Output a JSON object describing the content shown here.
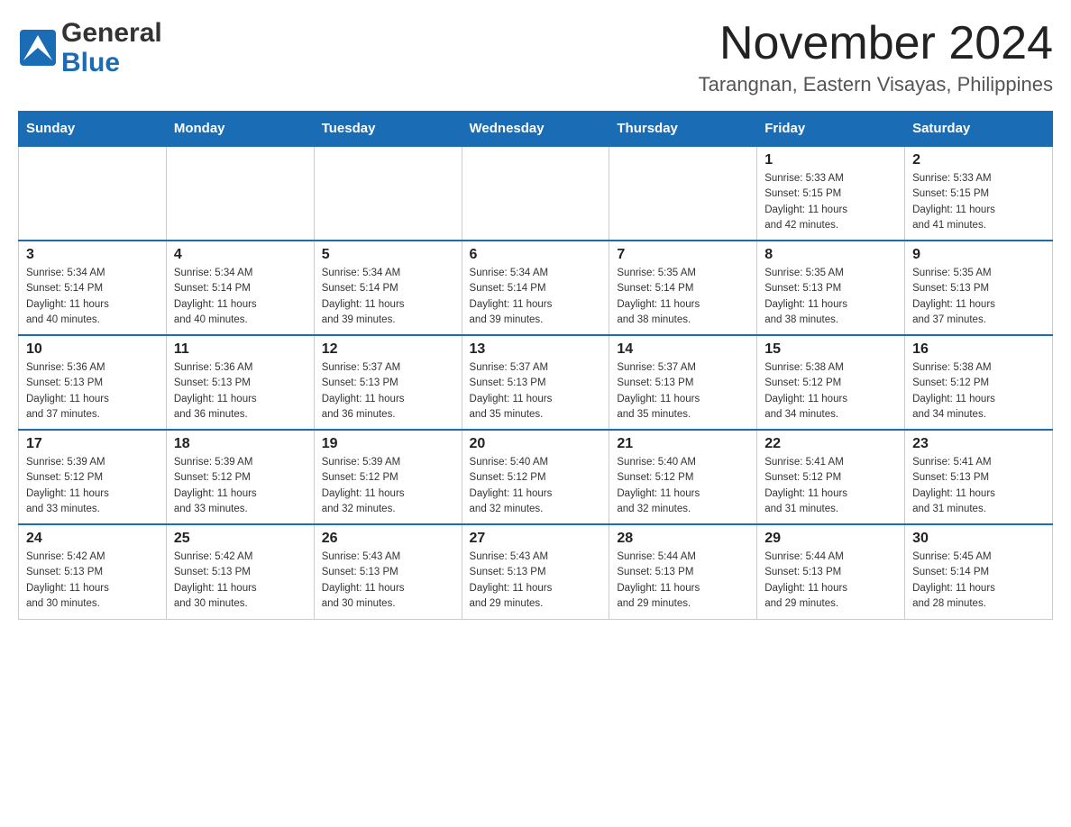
{
  "header": {
    "logo_general": "General",
    "logo_blue": "Blue",
    "month_title": "November 2024",
    "location": "Tarangnan, Eastern Visayas, Philippines"
  },
  "days_of_week": [
    "Sunday",
    "Monday",
    "Tuesday",
    "Wednesday",
    "Thursday",
    "Friday",
    "Saturday"
  ],
  "weeks": [
    {
      "days": [
        {
          "day": "",
          "info": ""
        },
        {
          "day": "",
          "info": ""
        },
        {
          "day": "",
          "info": ""
        },
        {
          "day": "",
          "info": ""
        },
        {
          "day": "",
          "info": ""
        },
        {
          "day": "1",
          "info": "Sunrise: 5:33 AM\nSunset: 5:15 PM\nDaylight: 11 hours\nand 42 minutes."
        },
        {
          "day": "2",
          "info": "Sunrise: 5:33 AM\nSunset: 5:15 PM\nDaylight: 11 hours\nand 41 minutes."
        }
      ]
    },
    {
      "days": [
        {
          "day": "3",
          "info": "Sunrise: 5:34 AM\nSunset: 5:14 PM\nDaylight: 11 hours\nand 40 minutes."
        },
        {
          "day": "4",
          "info": "Sunrise: 5:34 AM\nSunset: 5:14 PM\nDaylight: 11 hours\nand 40 minutes."
        },
        {
          "day": "5",
          "info": "Sunrise: 5:34 AM\nSunset: 5:14 PM\nDaylight: 11 hours\nand 39 minutes."
        },
        {
          "day": "6",
          "info": "Sunrise: 5:34 AM\nSunset: 5:14 PM\nDaylight: 11 hours\nand 39 minutes."
        },
        {
          "day": "7",
          "info": "Sunrise: 5:35 AM\nSunset: 5:14 PM\nDaylight: 11 hours\nand 38 minutes."
        },
        {
          "day": "8",
          "info": "Sunrise: 5:35 AM\nSunset: 5:13 PM\nDaylight: 11 hours\nand 38 minutes."
        },
        {
          "day": "9",
          "info": "Sunrise: 5:35 AM\nSunset: 5:13 PM\nDaylight: 11 hours\nand 37 minutes."
        }
      ]
    },
    {
      "days": [
        {
          "day": "10",
          "info": "Sunrise: 5:36 AM\nSunset: 5:13 PM\nDaylight: 11 hours\nand 37 minutes."
        },
        {
          "day": "11",
          "info": "Sunrise: 5:36 AM\nSunset: 5:13 PM\nDaylight: 11 hours\nand 36 minutes."
        },
        {
          "day": "12",
          "info": "Sunrise: 5:37 AM\nSunset: 5:13 PM\nDaylight: 11 hours\nand 36 minutes."
        },
        {
          "day": "13",
          "info": "Sunrise: 5:37 AM\nSunset: 5:13 PM\nDaylight: 11 hours\nand 35 minutes."
        },
        {
          "day": "14",
          "info": "Sunrise: 5:37 AM\nSunset: 5:13 PM\nDaylight: 11 hours\nand 35 minutes."
        },
        {
          "day": "15",
          "info": "Sunrise: 5:38 AM\nSunset: 5:12 PM\nDaylight: 11 hours\nand 34 minutes."
        },
        {
          "day": "16",
          "info": "Sunrise: 5:38 AM\nSunset: 5:12 PM\nDaylight: 11 hours\nand 34 minutes."
        }
      ]
    },
    {
      "days": [
        {
          "day": "17",
          "info": "Sunrise: 5:39 AM\nSunset: 5:12 PM\nDaylight: 11 hours\nand 33 minutes."
        },
        {
          "day": "18",
          "info": "Sunrise: 5:39 AM\nSunset: 5:12 PM\nDaylight: 11 hours\nand 33 minutes."
        },
        {
          "day": "19",
          "info": "Sunrise: 5:39 AM\nSunset: 5:12 PM\nDaylight: 11 hours\nand 32 minutes."
        },
        {
          "day": "20",
          "info": "Sunrise: 5:40 AM\nSunset: 5:12 PM\nDaylight: 11 hours\nand 32 minutes."
        },
        {
          "day": "21",
          "info": "Sunrise: 5:40 AM\nSunset: 5:12 PM\nDaylight: 11 hours\nand 32 minutes."
        },
        {
          "day": "22",
          "info": "Sunrise: 5:41 AM\nSunset: 5:12 PM\nDaylight: 11 hours\nand 31 minutes."
        },
        {
          "day": "23",
          "info": "Sunrise: 5:41 AM\nSunset: 5:13 PM\nDaylight: 11 hours\nand 31 minutes."
        }
      ]
    },
    {
      "days": [
        {
          "day": "24",
          "info": "Sunrise: 5:42 AM\nSunset: 5:13 PM\nDaylight: 11 hours\nand 30 minutes."
        },
        {
          "day": "25",
          "info": "Sunrise: 5:42 AM\nSunset: 5:13 PM\nDaylight: 11 hours\nand 30 minutes."
        },
        {
          "day": "26",
          "info": "Sunrise: 5:43 AM\nSunset: 5:13 PM\nDaylight: 11 hours\nand 30 minutes."
        },
        {
          "day": "27",
          "info": "Sunrise: 5:43 AM\nSunset: 5:13 PM\nDaylight: 11 hours\nand 29 minutes."
        },
        {
          "day": "28",
          "info": "Sunrise: 5:44 AM\nSunset: 5:13 PM\nDaylight: 11 hours\nand 29 minutes."
        },
        {
          "day": "29",
          "info": "Sunrise: 5:44 AM\nSunset: 5:13 PM\nDaylight: 11 hours\nand 29 minutes."
        },
        {
          "day": "30",
          "info": "Sunrise: 5:45 AM\nSunset: 5:14 PM\nDaylight: 11 hours\nand 28 minutes."
        }
      ]
    }
  ]
}
